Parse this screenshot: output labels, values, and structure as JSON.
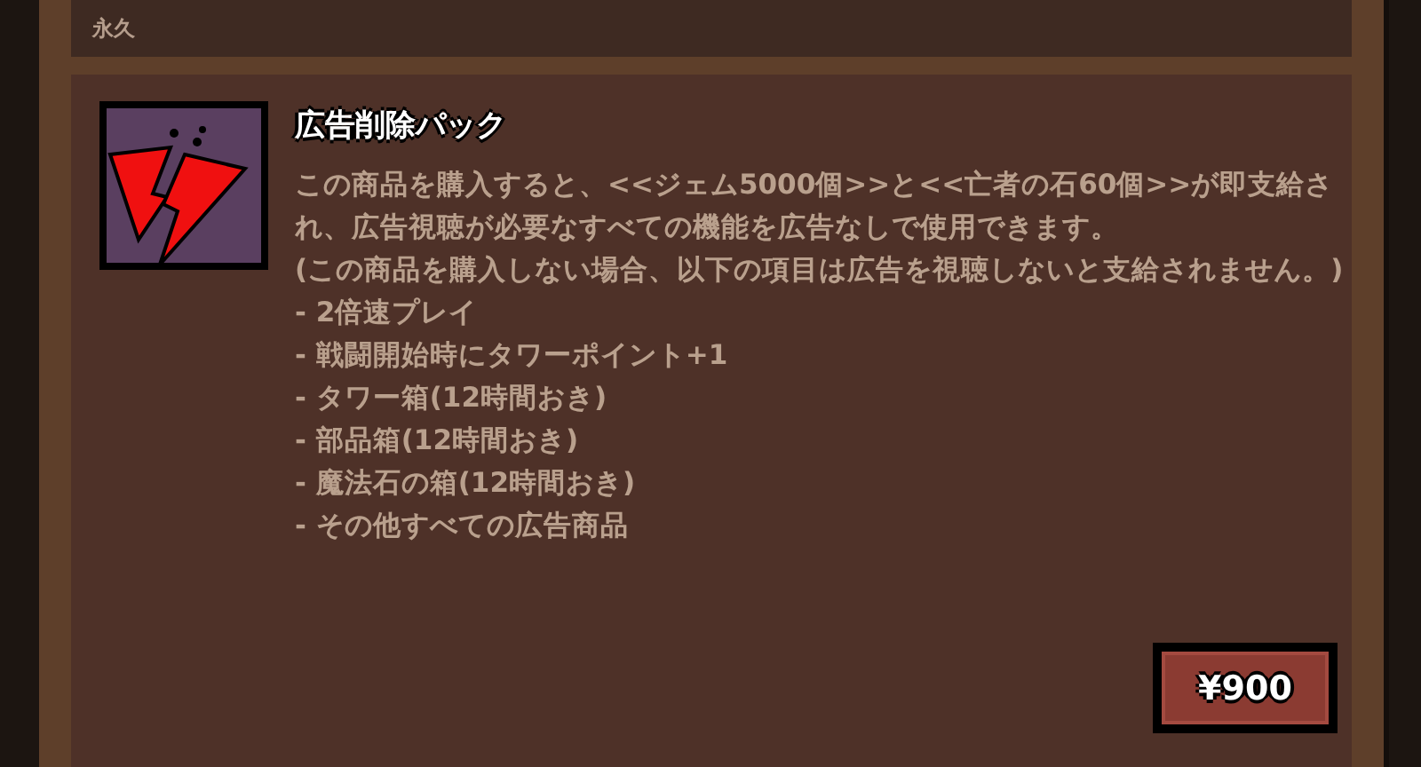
{
  "header": {
    "label": "永久"
  },
  "product": {
    "kind": "picture-icon",
    "title": "広告削除パック",
    "paragraphs": [
      "この商品を購入すると、<<ジェム5000個>>と<<亡者の石60個>>が即支給され、広告視聴が必要なすべての機能を広告なしで使用できます。",
      "(この商品を購入しない場合、以下の項目は広告を視聴しないと支給されません。)"
    ],
    "items": [
      "- 2倍速プレイ",
      "- 戦闘開始時にタワーポイント+1",
      "- タワー箱(12時間おき)",
      "- 部品箱(12時間おき)",
      "- 魔法石の箱(12時間おき)",
      "- その他すべての広告商品"
    ],
    "price": "¥900"
  }
}
